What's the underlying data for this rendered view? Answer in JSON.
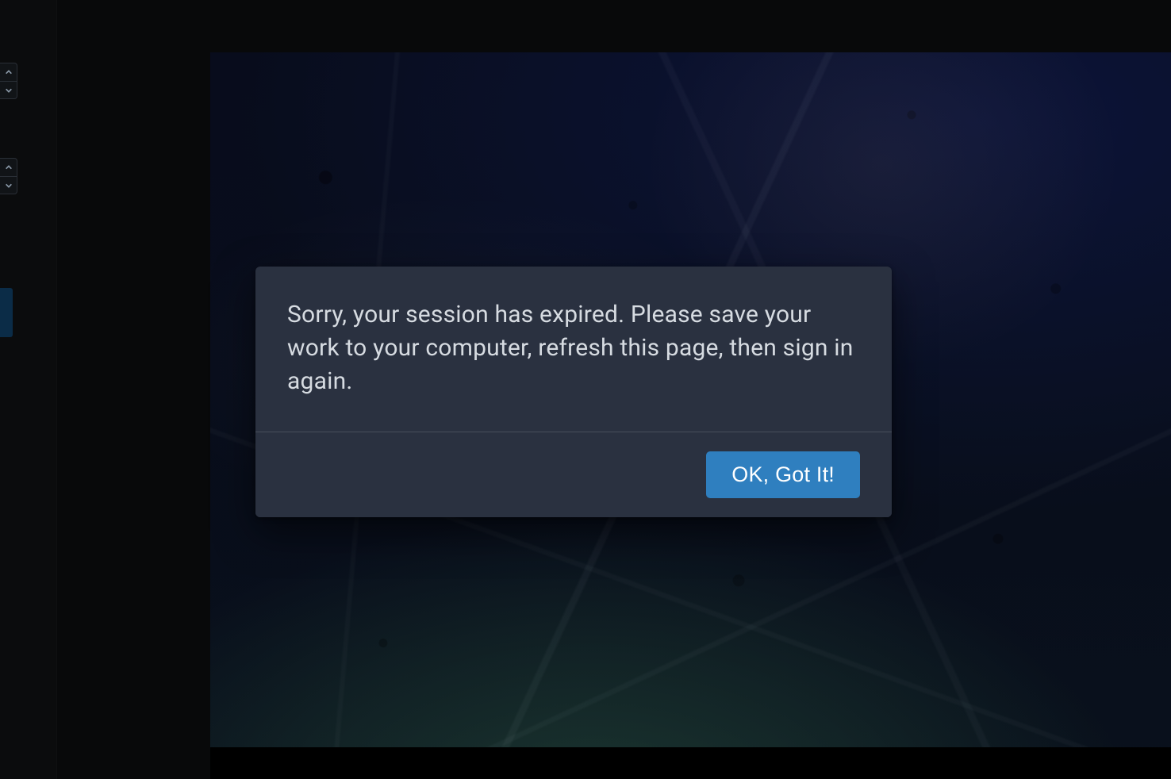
{
  "sidebar": {
    "stepper1": {
      "up_icon": "chevron-up",
      "down_icon": "chevron-down"
    },
    "stepper2": {
      "up_icon": "chevron-up",
      "down_icon": "chevron-down"
    }
  },
  "modal": {
    "message": "Sorry, your session has expired. Please save your work to your computer, refresh this page, then sign in again.",
    "confirm_label": "OK, Got It!"
  },
  "colors": {
    "modal_bg": "#2a3140",
    "primary_button": "#2f7fbf",
    "text": "#d6dbe1"
  }
}
